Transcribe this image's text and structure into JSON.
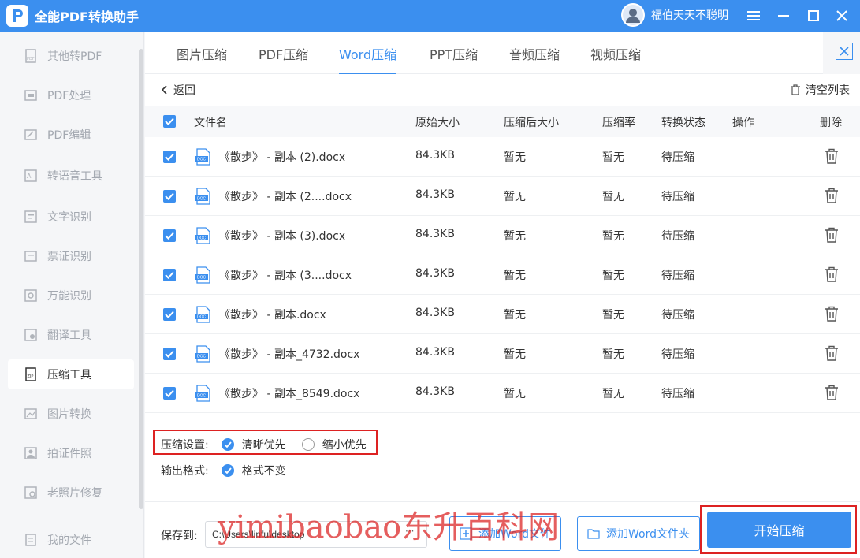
{
  "app": {
    "title": "全能PDF转换助手",
    "username": "福伯天天不聪明"
  },
  "sidebar": {
    "items": [
      {
        "label": "其他转PDF"
      },
      {
        "label": "PDF处理"
      },
      {
        "label": "PDF编辑"
      },
      {
        "label": "转语音工具"
      },
      {
        "label": "文字识别"
      },
      {
        "label": "票证识别"
      },
      {
        "label": "万能识别"
      },
      {
        "label": "翻译工具"
      },
      {
        "label": "压缩工具"
      },
      {
        "label": "图片转换"
      },
      {
        "label": "拍证件照"
      },
      {
        "label": "老照片修复"
      },
      {
        "label": "我的文件"
      }
    ],
    "active_index": 8
  },
  "tabs": [
    {
      "label": "图片压缩"
    },
    {
      "label": "PDF压缩"
    },
    {
      "label": "Word压缩"
    },
    {
      "label": "PPT压缩"
    },
    {
      "label": "音频压缩"
    },
    {
      "label": "视频压缩"
    }
  ],
  "toolbar": {
    "back_label": "返回",
    "clear_label": "清空列表"
  },
  "table": {
    "headers": {
      "name": "文件名",
      "orig": "原始大小",
      "after": "压缩后大小",
      "rate": "压缩率",
      "status": "转换状态",
      "op": "操作",
      "del": "删除"
    },
    "rows": [
      {
        "name": "《散步》 - 副本 (2).docx",
        "orig": "84.3KB",
        "after": "暂无",
        "rate": "暂无",
        "status": "待压缩"
      },
      {
        "name": "《散步》 - 副本 (2....docx",
        "orig": "84.3KB",
        "after": "暂无",
        "rate": "暂无",
        "status": "待压缩"
      },
      {
        "name": "《散步》 - 副本 (3).docx",
        "orig": "84.3KB",
        "after": "暂无",
        "rate": "暂无",
        "status": "待压缩"
      },
      {
        "name": "《散步》 - 副本 (3....docx",
        "orig": "84.3KB",
        "after": "暂无",
        "rate": "暂无",
        "status": "待压缩"
      },
      {
        "name": "《散步》 - 副本.docx",
        "orig": "84.3KB",
        "after": "暂无",
        "rate": "暂无",
        "status": "待压缩"
      },
      {
        "name": "《散步》 - 副本_4732.docx",
        "orig": "84.3KB",
        "after": "暂无",
        "rate": "暂无",
        "status": "待压缩"
      },
      {
        "name": "《散步》 - 副本_8549.docx",
        "orig": "84.3KB",
        "after": "暂无",
        "rate": "暂无",
        "status": "待压缩"
      }
    ],
    "doc_icon_label": "DOC"
  },
  "settings": {
    "compress_label": "压缩设置:",
    "option_clear": "清晰优先",
    "option_small": "缩小优先",
    "output_label": "输出格式:",
    "output_option": "格式不变"
  },
  "bottom": {
    "save_label": "保存到:",
    "path_value": "C:\\Users\\linfu\\desktop",
    "more": "···",
    "add_file": "添加Word文件",
    "add_folder": "添加Word文件夹",
    "start": "开始压缩"
  },
  "watermark": "yimibaobao东升百科网",
  "colors": {
    "accent": "#3b8fef",
    "highlight_border": "#dd2222"
  }
}
